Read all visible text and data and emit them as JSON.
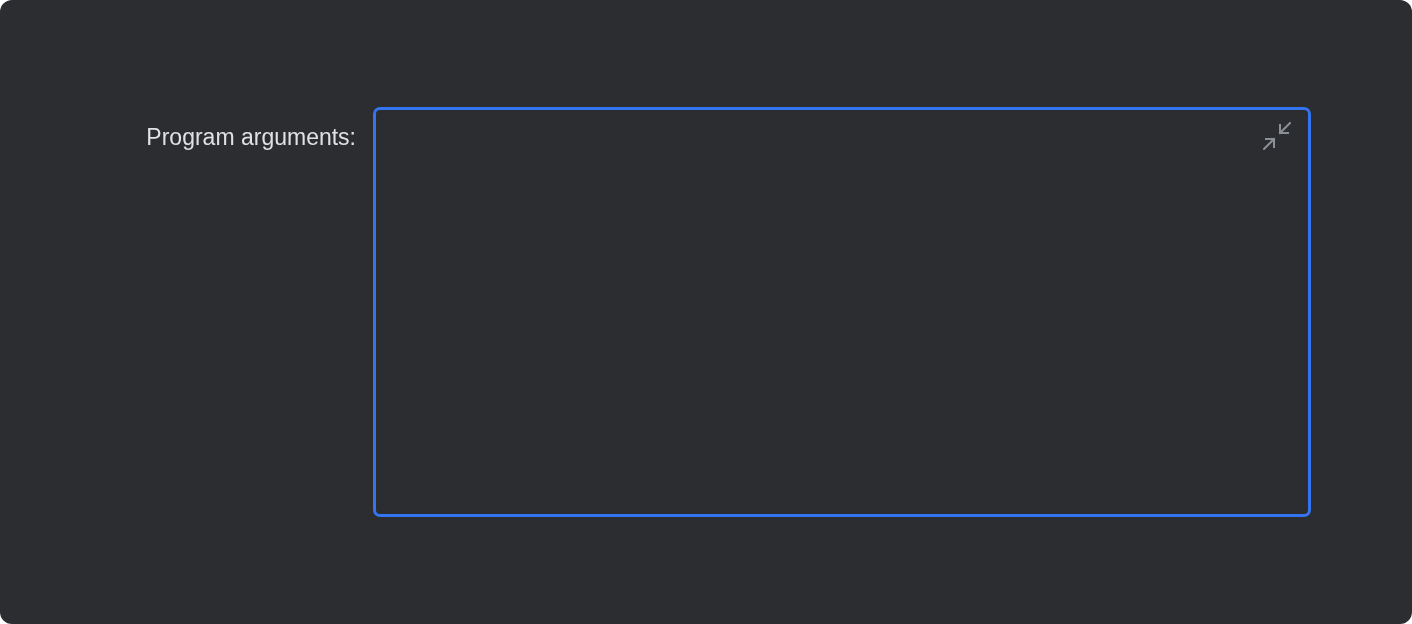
{
  "form": {
    "label": "Program arguments:",
    "field": {
      "focused": true
    }
  }
}
